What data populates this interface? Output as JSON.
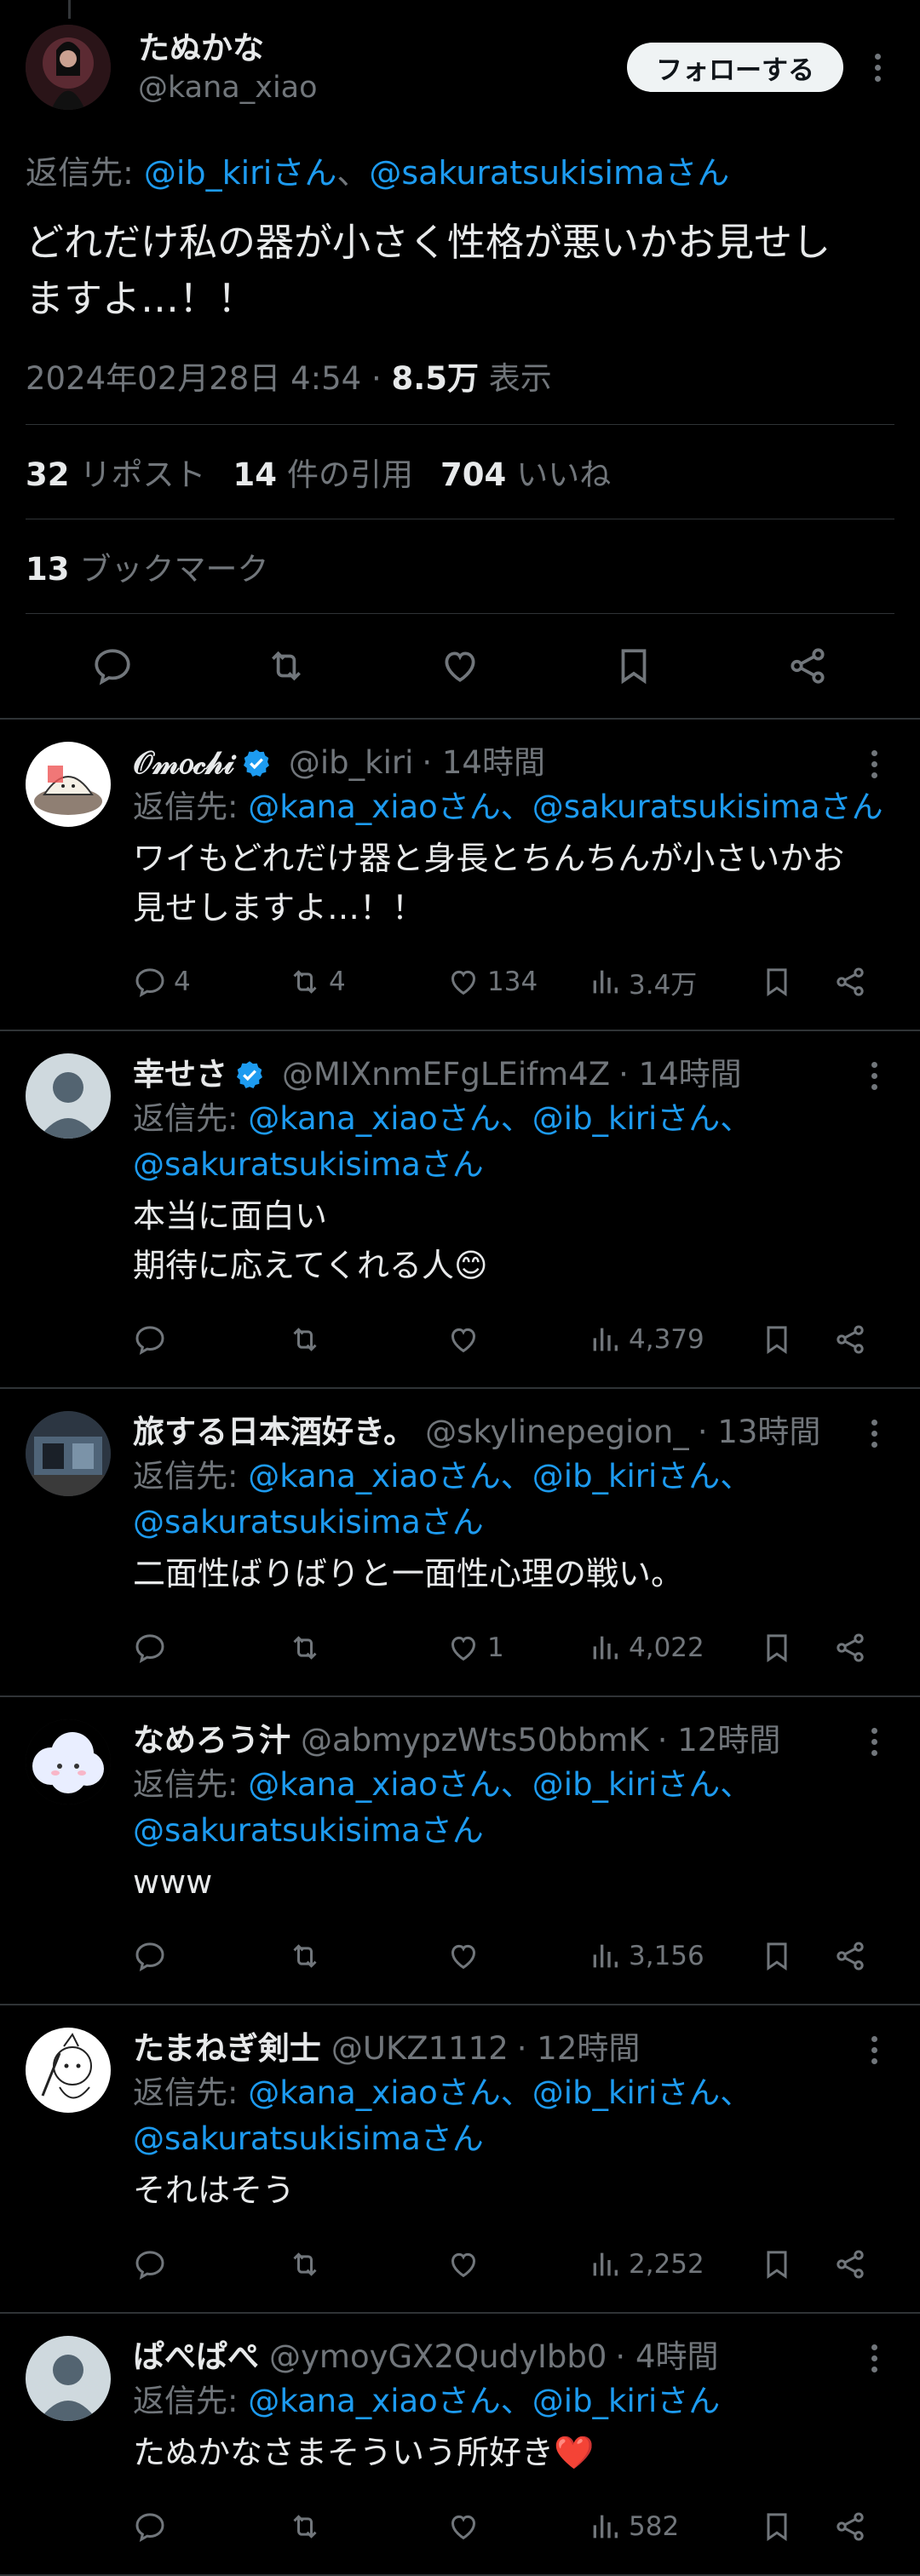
{
  "main_tweet": {
    "author_name": "たぬかな",
    "author_handle": "@kana_xiao",
    "follow_label": "フォローする",
    "reply_to_prefix": "返信先: ",
    "reply_to_mentions": [
      "@ib_kiriさん",
      "@sakuratsukisimaさん"
    ],
    "text": "どれだけ私の器が小さく性格が悪いかお見せし\nますよ…！！",
    "timestamp": "2024年02月28日 4:54",
    "views_value": "8.5万",
    "views_label": "表示",
    "reposts": "32",
    "reposts_label": "リポスト",
    "quotes": "14",
    "quotes_label": "件の引用",
    "likes": "704",
    "likes_label": "いいね",
    "bookmarks": "13",
    "bookmarks_label": "ブックマーク"
  },
  "icons": {
    "reply": "reply-icon",
    "retweet": "retweet-icon",
    "like": "heart-icon",
    "bookmark": "bookmark-icon",
    "share": "share-icon",
    "views": "views-chart-icon",
    "verified": "verified-badge-icon",
    "more": "more-icon"
  },
  "colors": {
    "accent": "#1d9bf0",
    "background": "#000000",
    "muted": "#71767b"
  },
  "replies": [
    {
      "name": "𝒪𝓂𝑜𝒸𝒽𝒾",
      "verified": true,
      "handle": "@ib_kiri",
      "time": "· 14時間",
      "reply_to": "返信先: ",
      "mentions": "@kana_xiaoさん、@sakuratsukisimaさん",
      "text": "ワイもどれだけ器と身長とちんちんが小さいかお\n見せしますよ…！！",
      "reply_count": "4",
      "retweet_count": "4",
      "like_count": "134",
      "views": "3.4万",
      "avatar": "omochi"
    },
    {
      "name": "幸せさ",
      "verified": true,
      "handle": "@MIXnmEFgLEifm4Z",
      "time": "· 14時間",
      "reply_to": "返信先: ",
      "mentions": "@kana_xiaoさん、@ib_kiriさん、\n@sakuratsukisimaさん",
      "text": "本当に面白い\n期待に応えてくれる人😊",
      "reply_count": "",
      "retweet_count": "",
      "like_count": "",
      "views": "4,379",
      "avatar": "default"
    },
    {
      "name": "旅する日本酒好き。",
      "verified": false,
      "handle": "@skylinepegion_",
      "time": "· 13時間",
      "reply_to": "返信先: ",
      "mentions": "@kana_xiaoさん、@ib_kiriさん、\n@sakuratsukisimaさん",
      "text": "二面性ばりばりと一面性心理の戦い。",
      "reply_count": "",
      "retweet_count": "",
      "like_count": "1",
      "views": "4,022",
      "avatar": "photo"
    },
    {
      "name": "なめろう汁",
      "verified": false,
      "handle": "@abmypzWts50bbmK",
      "time": "· 12時間",
      "reply_to": "返信先: ",
      "mentions": "@kana_xiaoさん、@ib_kiriさん、\n@sakuratsukisimaさん",
      "text": "www",
      "reply_count": "",
      "retweet_count": "",
      "like_count": "",
      "views": "3,156",
      "avatar": "cloud"
    },
    {
      "name": "たまねぎ剣士",
      "verified": false,
      "handle": "@UKZ1112",
      "time": "· 12時間",
      "reply_to": "返信先: ",
      "mentions": "@kana_xiaoさん、@ib_kiriさん、\n@sakuratsukisimaさん",
      "text": "それはそう",
      "reply_count": "",
      "retweet_count": "",
      "like_count": "",
      "views": "2,252",
      "avatar": "sketch"
    },
    {
      "name": "ぱぺぱぺ",
      "verified": false,
      "handle": "@ymoyGX2QudyIbb0",
      "time": "· 4時間",
      "reply_to": "返信先: ",
      "mentions": "@kana_xiaoさん、@ib_kiriさん",
      "text": "たぬかなさまそういう所好き❤️",
      "reply_count": "",
      "retweet_count": "",
      "like_count": "",
      "views": "582",
      "avatar": "default"
    }
  ]
}
